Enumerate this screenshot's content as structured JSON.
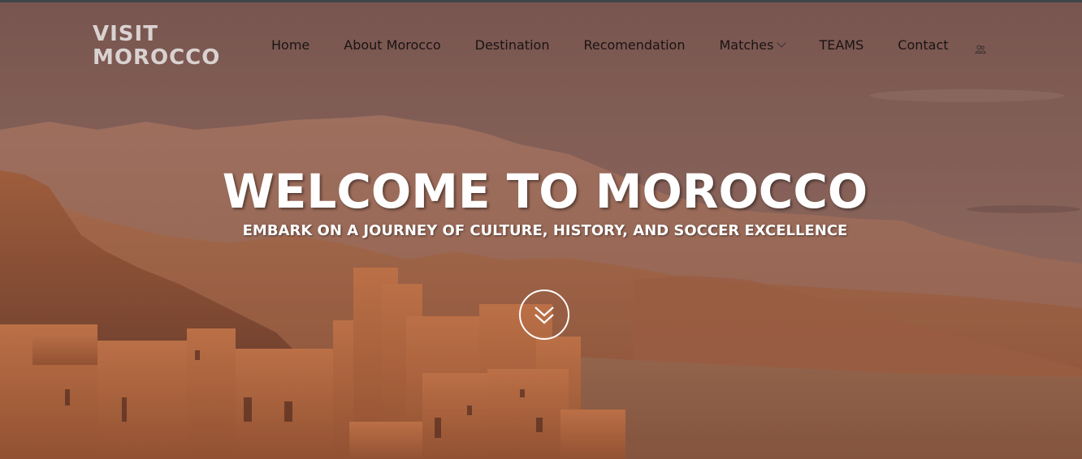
{
  "logo": {
    "line1": "VISIT",
    "line2": "MOROCCO"
  },
  "nav": {
    "items": [
      {
        "label": "Home"
      },
      {
        "label": "About Morocco"
      },
      {
        "label": "Destination"
      },
      {
        "label": "Recomendation"
      },
      {
        "label": "Matches",
        "has_dropdown": true
      },
      {
        "label": "TEAMS"
      },
      {
        "label": "Contact"
      }
    ],
    "user_icon": "user-group-icon"
  },
  "hero": {
    "title": "WELCOME TO MOROCCO",
    "subtitle": "EMBARK ON A JOURNEY OF CULTURE, HISTORY, AND SOCCER EXCELLENCE",
    "scroll_icon": "double-chevron-down-icon"
  },
  "colors": {
    "sky": "#8a6258",
    "mountains": "#a86a4e",
    "kasbah": "#b8683e",
    "nav_text": "#1a1414",
    "logo_text": "#d9d2d0",
    "top_strip": "#3e4648"
  }
}
